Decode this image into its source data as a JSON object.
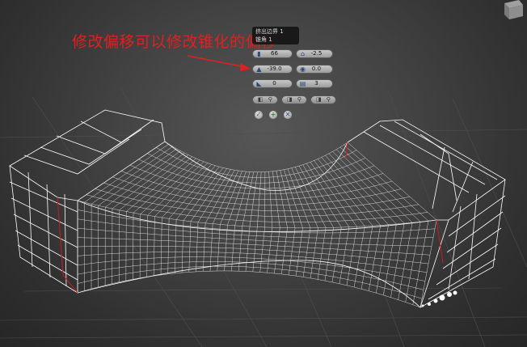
{
  "annotation": {
    "text": "修改偏移可以修改锥化的偏移",
    "color": "#e02020"
  },
  "caddy": {
    "title_line1": "挤出边界 1",
    "title_line2": "锥角 1",
    "segments": {
      "icon": "segments-icon",
      "value": "66"
    },
    "amount": {
      "icon": "taper-amount-icon",
      "value": "-2.5"
    },
    "offset": {
      "icon": "taper-offset-icon",
      "value": "-39.0"
    },
    "twist": {
      "icon": "twist-icon",
      "value": "0.0"
    },
    "field5": {
      "icon": "smooth-icon",
      "value": "0"
    },
    "field6": {
      "icon": "group-icon",
      "value": "3"
    },
    "ok_icon": "check-icon",
    "apply_icon": "plus-icon",
    "cancel_icon": "cancel-icon"
  },
  "colors": {
    "wire": "#ffffff",
    "edge_highlight": "#c81e1e",
    "grid": "#555555"
  }
}
